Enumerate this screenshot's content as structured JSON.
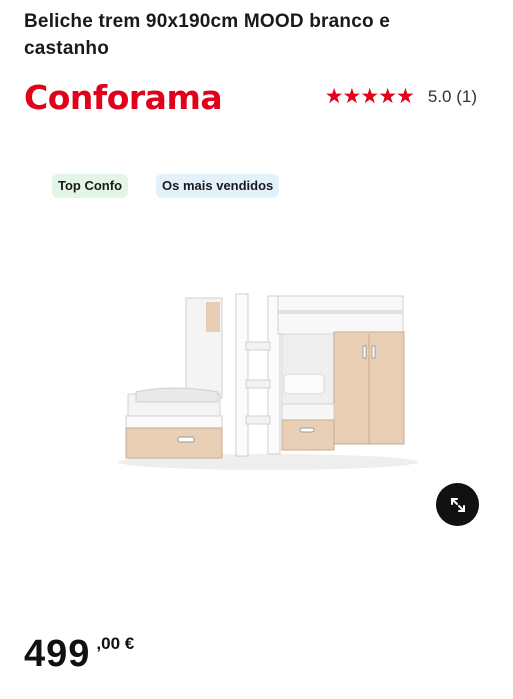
{
  "product": {
    "title": "Beliche trem 90x190cm MOOD branco e castanho",
    "price_integer": "499",
    "price_decimal": ",00 €"
  },
  "brand": {
    "logo_text": "Conforama",
    "color": "#e2001a"
  },
  "rating": {
    "stars": "★★★★★",
    "text": "5.0 (1)",
    "value": 5.0,
    "max": 5
  },
  "badges": [
    {
      "label": "Top Confo",
      "color": "#e3f5e6"
    },
    {
      "label": "Os mais vendidos",
      "color": "#e3f1fb"
    }
  ],
  "image": {
    "subject": "bunk bed white and wood",
    "zoom_icon": "expand-arrows-icon"
  }
}
